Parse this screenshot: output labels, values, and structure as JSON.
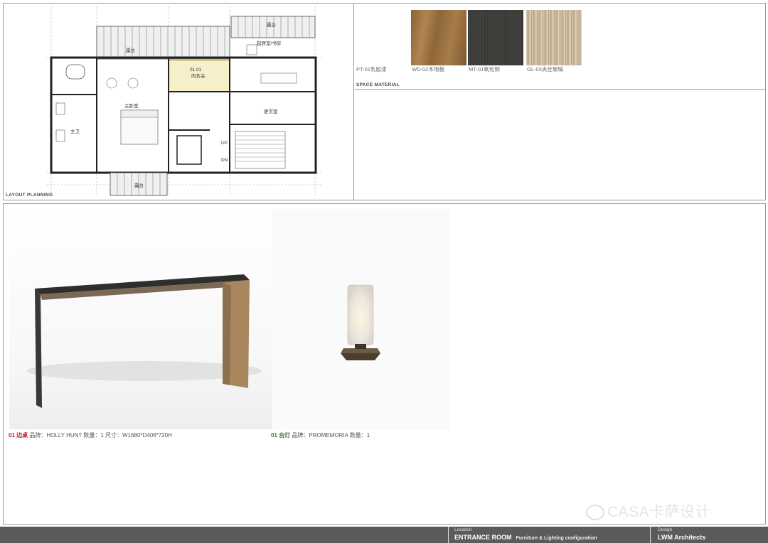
{
  "layout_panel": {
    "label": "LAYOUT  PLANNING",
    "rooms": {
      "terrace_top": "露台",
      "terrace_right": "露台",
      "terrace_bottom": "露台",
      "master_bedroom": "主卧室",
      "master_bath": "主卫",
      "foyer_code": "01  01",
      "foyer": "内玄关",
      "living_study": "起居室/书房",
      "dressing_room": "更衣室",
      "stair_up": "UP",
      "stair_down": "DN"
    }
  },
  "materials_panel": {
    "label": "SPACE  MATERIAL",
    "items": [
      {
        "code": "PT-01乳胶漆",
        "color": "#ffffff"
      },
      {
        "code": "WD-02木地板",
        "color": "#9b7444"
      },
      {
        "code": "MT-01氧化铜",
        "color": "#3c3c3a"
      },
      {
        "code": "GL-03夹丝玻璃",
        "color": "#c9b69a"
      }
    ]
  },
  "products": [
    {
      "num": "01",
      "name": "边桌",
      "details": "品牌：HOLLY HUNT  数量：1  尺寸：W1680*D406*720H",
      "color": "#b3262b"
    },
    {
      "num": "01",
      "name": "台灯",
      "details": "品牌：PROMEMORIA  数量：1",
      "color": "#3a7a3a"
    }
  ],
  "footer": {
    "location_label": "Location",
    "location_value": "ENTRANCE ROOM",
    "location_sub": "Furniture & Lighting configuration",
    "design_label": "Design",
    "design_value": "LWM  Architects"
  },
  "watermark": "CASA卡萨设计"
}
